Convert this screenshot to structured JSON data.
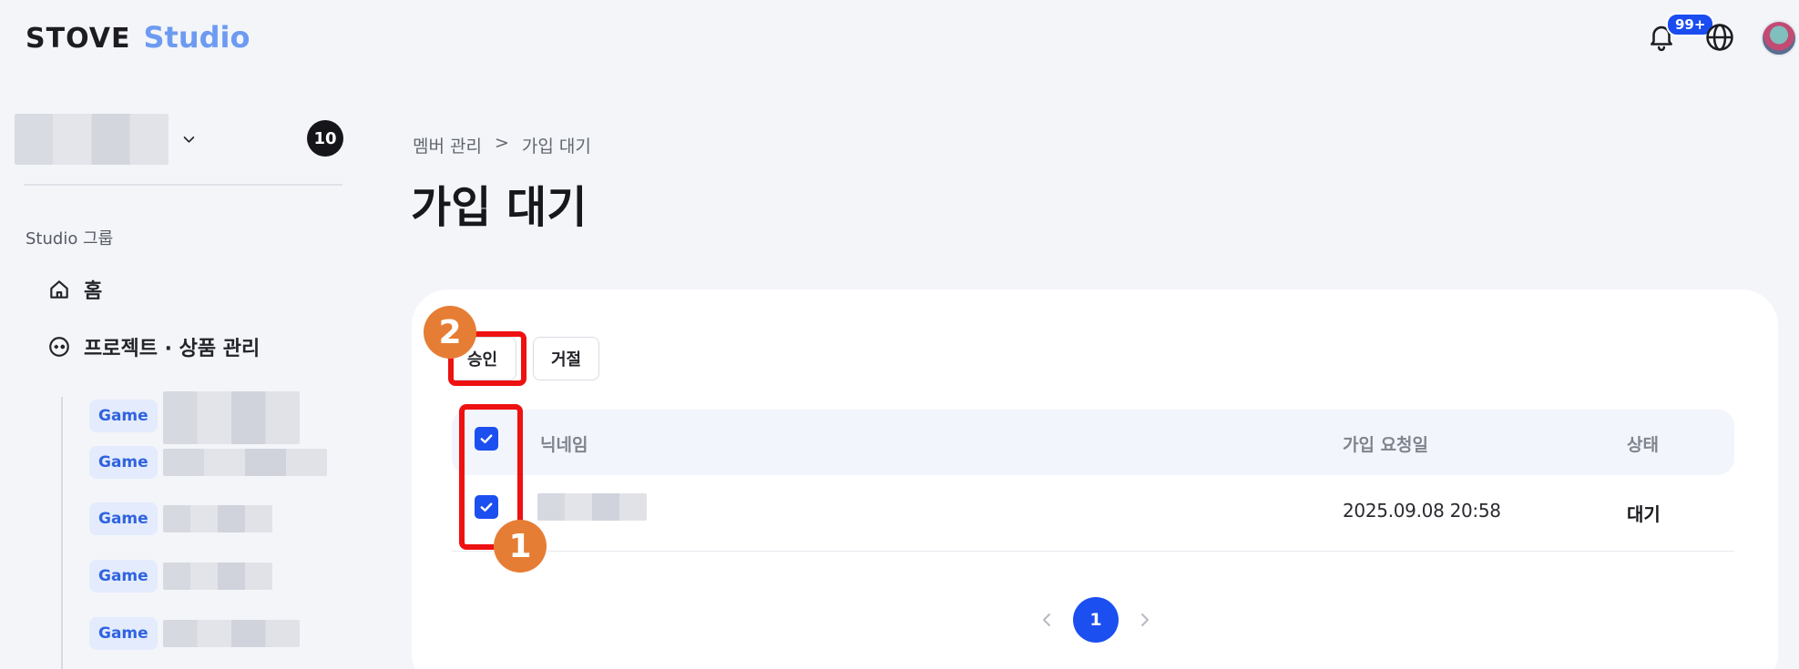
{
  "header": {
    "brand": "STOVE",
    "product": "Studio",
    "notification_count": "99+",
    "icons": [
      "bell-icon",
      "globe-icon",
      "avatar"
    ]
  },
  "sidebar": {
    "member_count": "10",
    "group_label": "Studio 그룹",
    "nav": [
      {
        "label": "홈",
        "icon": "home-icon"
      },
      {
        "label": "프로젝트 · 상품 관리",
        "icon": "gamepad-icon"
      }
    ],
    "game_items": [
      {
        "tag": "Game"
      },
      {
        "tag": "Game"
      },
      {
        "tag": "Game"
      },
      {
        "tag": "Game"
      },
      {
        "tag": "Game"
      }
    ]
  },
  "breadcrumb": {
    "items": [
      "멤버 관리",
      "가입 대기"
    ],
    "separator": ">"
  },
  "page": {
    "title": "가입 대기"
  },
  "actions": {
    "approve": "승인",
    "reject": "거절"
  },
  "table": {
    "columns": [
      "닉네임",
      "가입 요청일",
      "상태"
    ],
    "rows": [
      {
        "nickname": "",
        "requested_at": "2025.09.08 20:58",
        "status": "대기",
        "checked": true
      }
    ],
    "select_all_checked": true
  },
  "pagination": {
    "current": "1"
  },
  "annotations": {
    "step1": "1",
    "step2": "2",
    "highlight_color": "#ee1111",
    "badge_color": "#e67d34"
  },
  "colors": {
    "accent": "#1c4fef",
    "studio_text": "#6d9bf1",
    "background": "#f3f5f9"
  }
}
